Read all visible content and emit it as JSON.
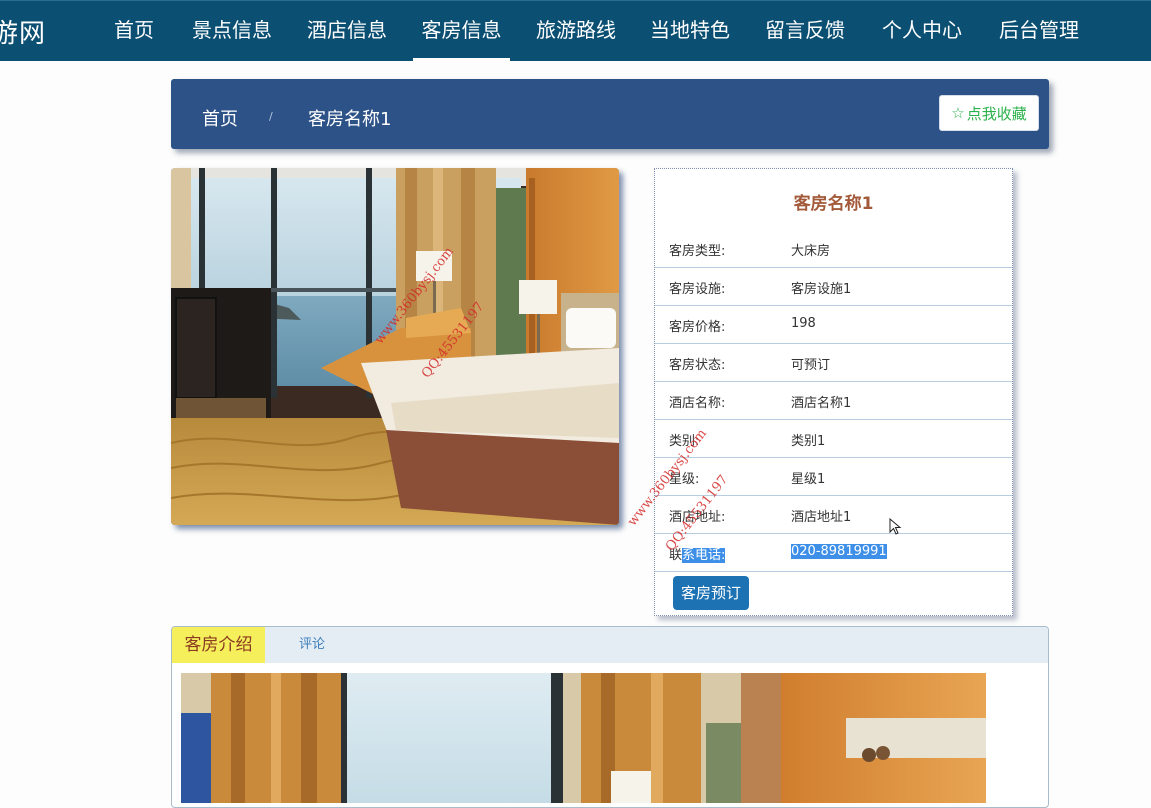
{
  "nav": {
    "logo": "游网",
    "items": [
      {
        "label": "首页"
      },
      {
        "label": "景点信息"
      },
      {
        "label": "酒店信息"
      },
      {
        "label": "客房信息"
      },
      {
        "label": "旅游路线"
      },
      {
        "label": "当地特色"
      },
      {
        "label": "留言反馈"
      },
      {
        "label": "个人中心"
      },
      {
        "label": "后台管理"
      }
    ],
    "active": "客房信息"
  },
  "breadcrumb": {
    "home": "首页",
    "separator": "/",
    "current": "客房名称1"
  },
  "favorite_label": "点我收藏",
  "room": {
    "title": "客房名称1",
    "fields": [
      {
        "label": "客房类型:",
        "value": "大床房"
      },
      {
        "label": "客房设施:",
        "value": "客房设施1"
      },
      {
        "label": "客房价格:",
        "value": "198"
      },
      {
        "label": "客房状态:",
        "value": "可预订"
      },
      {
        "label": "酒店名称:",
        "value": "酒店名称1"
      },
      {
        "label": "类别:",
        "value": "类别1"
      },
      {
        "label": "星级:",
        "value": "星级1"
      },
      {
        "label": "酒店地址:",
        "value": "酒店地址1"
      },
      {
        "label_pre": "联",
        "label_sel": "系电话:",
        "value": "020-89819991"
      }
    ],
    "book_label": "客房预订"
  },
  "tabs": [
    {
      "label": "客房介绍"
    },
    {
      "label": "评论"
    }
  ],
  "watermarks": {
    "site": "www.360bysj.com",
    "qq": "QQ:45531197"
  },
  "colors": {
    "nav_bg": "#0b4f72",
    "breadcrumb_bg": "#2d5287",
    "accent_title": "#a35a3a",
    "book_button": "#1d72b3",
    "favorite_text": "#2bb14a",
    "tab_active_bg": "#f5ef5b"
  }
}
